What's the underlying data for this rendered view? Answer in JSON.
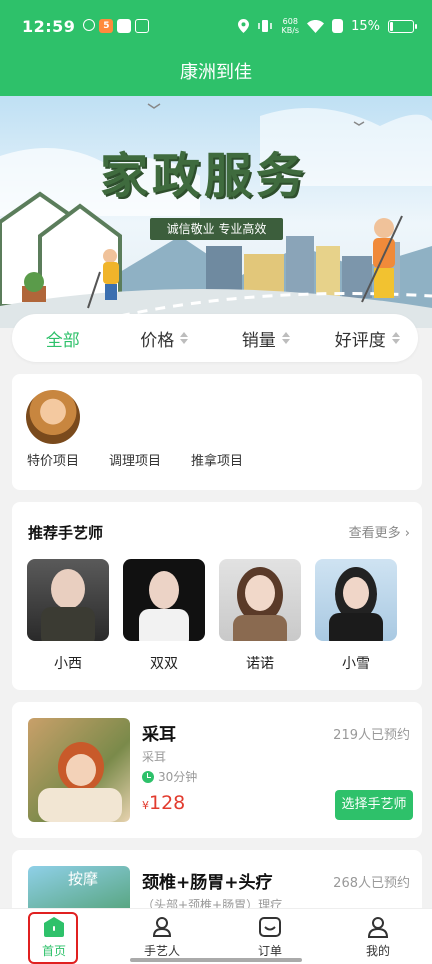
{
  "status": {
    "time": "12:59",
    "speed_top": "608",
    "speed_unit": "KB/s",
    "battery": "15%",
    "battery_level": 0.15
  },
  "app": {
    "title": "康洲到佳"
  },
  "banner": {
    "title": "家政服务",
    "subtitle": "诚信敬业 专业高效"
  },
  "sort": {
    "items": [
      {
        "label": "全部"
      },
      {
        "label": "价格"
      },
      {
        "label": "销量"
      },
      {
        "label": "好评度"
      }
    ]
  },
  "categories": [
    {
      "label": "特价项目"
    },
    {
      "label": "调理项目"
    },
    {
      "label": "推拿项目"
    }
  ],
  "artisans": {
    "title": "推荐手艺师",
    "see_more": "查看更多",
    "items": [
      {
        "name": "小西"
      },
      {
        "name": "双双"
      },
      {
        "name": "诺诺"
      },
      {
        "name": "小雪"
      }
    ]
  },
  "services": [
    {
      "title": "采耳",
      "booked": "219人已预约",
      "desc": "采耳",
      "duration": "30分钟",
      "currency": "¥",
      "price": "128",
      "button": "选择手艺师"
    },
    {
      "title": "颈椎+肠胃+头疗",
      "booked": "268人已预约",
      "desc": "（头部+颈椎+肠胃）理疗",
      "img_text": "按摩"
    }
  ],
  "tabbar": {
    "items": [
      {
        "label": "首页"
      },
      {
        "label": "手艺人"
      },
      {
        "label": "订单"
      },
      {
        "label": "我的"
      }
    ]
  },
  "colors": {
    "primary": "#2ec16a",
    "price": "#e23b2e",
    "highlight": "#e02020"
  }
}
